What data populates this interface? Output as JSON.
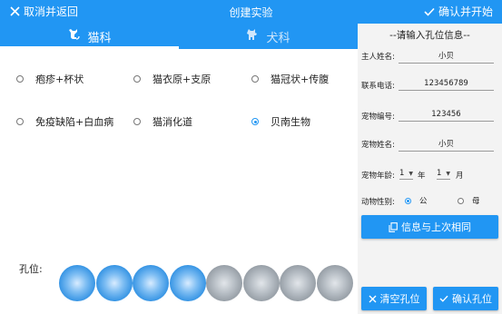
{
  "topbar": {
    "cancel_label": "取消并返回",
    "title": "创建实验",
    "confirm_label": "确认并开始"
  },
  "tabs": [
    {
      "label": "猫科",
      "icon": "cat-icon",
      "active": true
    },
    {
      "label": "犬科",
      "icon": "dog-icon",
      "active": false
    }
  ],
  "options": [
    {
      "label": "疱疹+杯状",
      "selected": false
    },
    {
      "label": "猫衣原+支原",
      "selected": false
    },
    {
      "label": "猫冠状+传腹",
      "selected": false
    },
    {
      "label": "免疫缺陷+白血病",
      "selected": false
    },
    {
      "label": "猫消化道",
      "selected": false
    },
    {
      "label": "贝南生物",
      "selected": true
    }
  ],
  "wells": {
    "label": "孔位:",
    "states": [
      "blue",
      "blue",
      "blue",
      "blue",
      "gray",
      "gray",
      "gray",
      "gray"
    ]
  },
  "panel": {
    "header": "--请输入孔位信息--",
    "owner_label": "主人姓名:",
    "owner_value": "小贝",
    "phone_label": "联系电话:",
    "phone_value": "123456789",
    "pet_id_label": "宠物编号:",
    "pet_id_value": "123456",
    "pet_name_label": "宠物姓名:",
    "pet_name_value": "小贝",
    "age_label": "宠物年龄:",
    "age_years": "1",
    "year_unit": "年",
    "age_months": "1",
    "month_unit": "月",
    "gender_label": "动物性别:",
    "gender_male": "公",
    "gender_female": "母",
    "gender_selected": "male",
    "same_as_last_label": "信息与上次相同",
    "clear_label": "清空孔位",
    "confirm_label": "确认孔位"
  },
  "colors": {
    "primary": "#2196f3",
    "panel_bg": "#f3f3f3"
  }
}
